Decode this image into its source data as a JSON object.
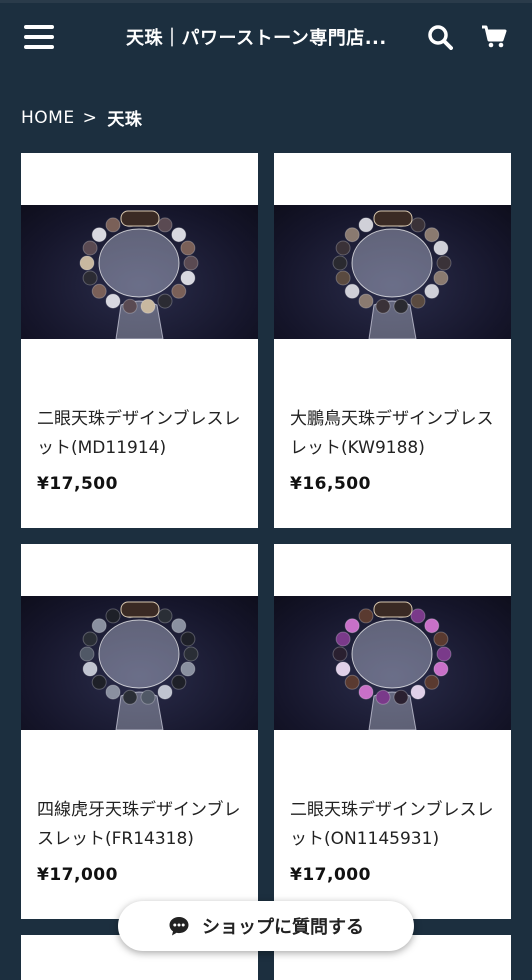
{
  "header": {
    "title": "天珠｜パワーストーン専門店...",
    "menu_icon": "hamburger-menu-icon",
    "search_icon": "search-icon",
    "cart_icon": "cart-icon"
  },
  "breadcrumb": {
    "home": "HOME",
    "separator": ">",
    "current": "天珠"
  },
  "products": [
    {
      "name": "二眼天珠デザインブレスレット(MD11914)",
      "price": "¥17,500",
      "bead_colors": [
        "#5a4a52",
        "#d8d8e0",
        "#7a6058",
        "#2b2b33",
        "#c8b8a0"
      ]
    },
    {
      "name": "大鵬鳥天珠デザインブレスレット(KW9188)",
      "price": "¥16,500",
      "bead_colors": [
        "#3a3238",
        "#8a7a70",
        "#d0d0d8",
        "#5a4a40",
        "#2a2a30"
      ]
    },
    {
      "name": "四線虎牙天珠デザインブレスレット(FR14318)",
      "price": "¥17,000",
      "bead_colors": [
        "#2a2e36",
        "#8a90a0",
        "#1e2028",
        "#c0c4d0",
        "#505866"
      ]
    },
    {
      "name": "二眼天珠デザインブレスレット(ON1145931)",
      "price": "¥17,000",
      "bead_colors": [
        "#7a3a8a",
        "#c870c8",
        "#5a3a30",
        "#e0d0e8",
        "#2a2030"
      ]
    }
  ],
  "ask_button": {
    "label": "ショップに質問する",
    "icon": "chat-bubble-icon"
  },
  "colors": {
    "background": "#1c2f3f",
    "card": "#ffffff"
  }
}
